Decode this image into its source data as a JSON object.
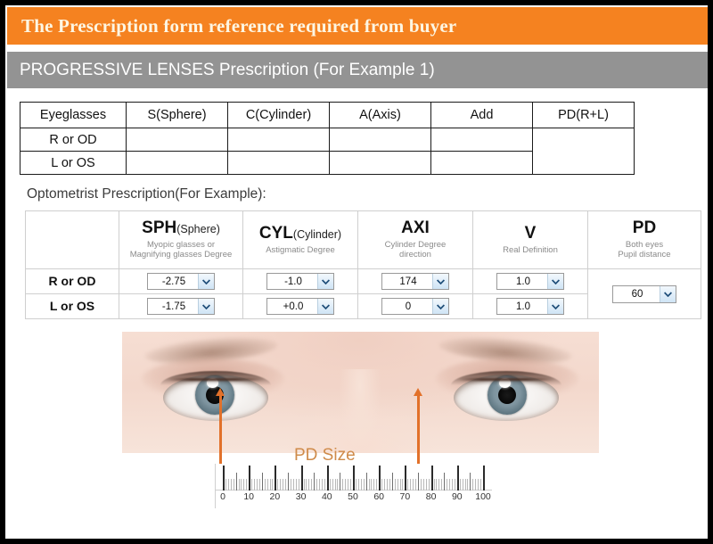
{
  "header": {
    "title": "The Prescription form reference required from buyer",
    "title_bg": "#f58220",
    "title_color": "#fdf6e3",
    "subtitle": "PROGRESSIVE LENSES Prescription (For Example 1)",
    "subtitle_bg": "#939393",
    "subtitle_color": "#ffffff"
  },
  "blank_table": {
    "columns": [
      "Eyeglasses",
      "S(Sphere)",
      "C(Cylinder)",
      "A(Axis)",
      "Add",
      "PD(R+L)"
    ],
    "rows": [
      {
        "label": "R or OD",
        "sphere": "",
        "cylinder": "",
        "axis": "",
        "add": ""
      },
      {
        "label": "L or OS",
        "sphere": "",
        "cylinder": "",
        "axis": "",
        "add": ""
      }
    ],
    "pd_merged_value": ""
  },
  "example_section": {
    "label": "Optometrist Prescription(For Example):",
    "columns": [
      {
        "main": "",
        "paren": "",
        "sub": ""
      },
      {
        "main": "SPH",
        "paren": "(Sphere)",
        "sub": "Myopic glasses or\nMagnifying glasses Degree"
      },
      {
        "main": "CYL",
        "paren": "(Cylinder)",
        "sub": "Astigmatic  Degree"
      },
      {
        "main": "AXI",
        "paren": "",
        "sub": "Cylinder Degree\ndirection"
      },
      {
        "main": "V",
        "paren": "",
        "sub": "Real Definition"
      },
      {
        "main": "PD",
        "paren": "",
        "sub": "Both eyes\nPupil distance"
      }
    ],
    "rows": [
      {
        "label": "R or OD",
        "sph": "-2.75",
        "cyl": "-1.0",
        "axi": "174",
        "v": "1.0"
      },
      {
        "label": "L or OS",
        "sph": "-1.75",
        "cyl": "+0.0",
        "axi": "0",
        "v": "1.0"
      }
    ],
    "pd_value": "60",
    "dropdown_icon": "chevron-down-icon"
  },
  "diagram": {
    "caption": "PD Size",
    "caption_color": "#cf8b4a",
    "pointer_color": "#e2712a",
    "ruler": {
      "labels": [
        "0",
        "10",
        "20",
        "30",
        "40",
        "50",
        "60",
        "70",
        "80",
        "90",
        "100"
      ],
      "min": 0,
      "max": 100,
      "major_step": 10,
      "minor_step": 1
    }
  }
}
